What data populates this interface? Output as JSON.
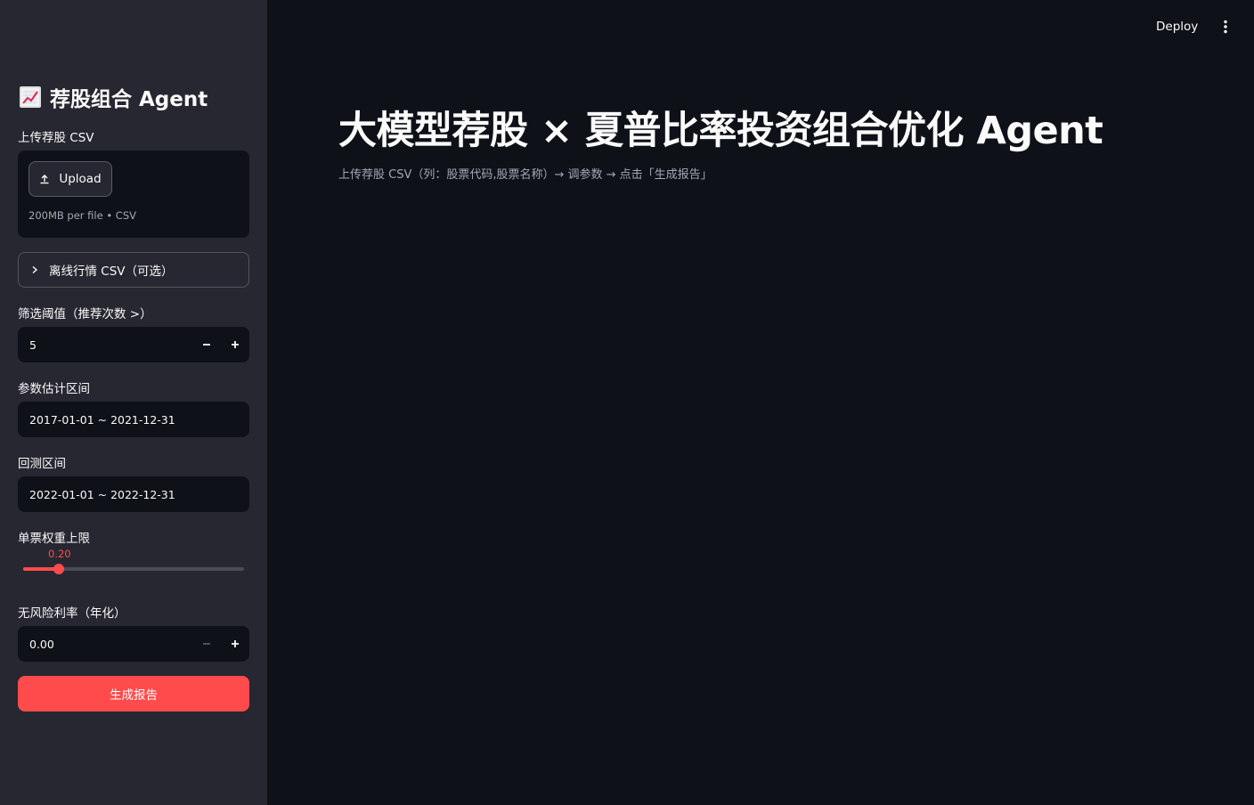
{
  "header": {
    "deploy_label": "Deploy"
  },
  "sidebar": {
    "title": "荐股组合 Agent",
    "title_icon": "chart-increasing-emoji",
    "upload": {
      "label": "上传荐股 CSV",
      "button_label": "Upload",
      "hint": "200MB per file • CSV"
    },
    "expander": {
      "label": "离线行情 CSV（可选）"
    },
    "threshold": {
      "label": "筛选阈值（推荐次数 >）",
      "value": "5"
    },
    "estimation_range": {
      "label": "参数估计区间",
      "value": "2017-01-01 ~ 2021-12-31"
    },
    "backtest_range": {
      "label": "回测区间",
      "value": "2022-01-01 ~ 2022-12-31"
    },
    "weight_cap": {
      "label": "单票权重上限",
      "value_text": "0.20",
      "fraction": 0.16
    },
    "risk_free": {
      "label": "无风险利率（年化）",
      "value": "0.00"
    },
    "generate_button": "生成报告"
  },
  "main": {
    "title": "大模型荐股 × 夏普比率投资组合优化 Agent",
    "caption": "上传荐股 CSV（列：股票代码,股票名称）→ 调参数 → 点击「生成报告」"
  },
  "colors": {
    "accent": "#ff4b4b",
    "background": "#0e1117",
    "sidebar": "#262730"
  }
}
